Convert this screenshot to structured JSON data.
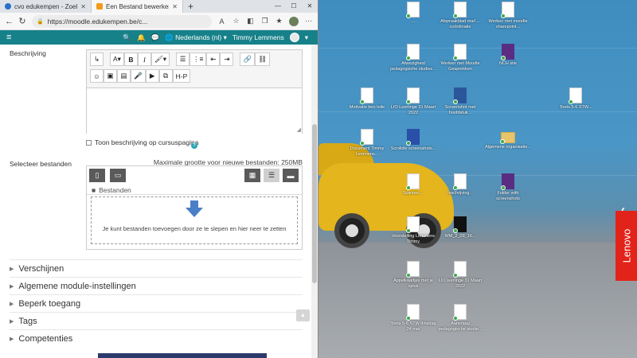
{
  "browser": {
    "tabs": [
      {
        "label": "cvo edukempen - Zoeken",
        "active": false
      },
      {
        "label": "Een Bestand bewerken",
        "active": true
      }
    ],
    "new_tab": "+",
    "url": "https://moodle.edukempen.be/c...",
    "window_controls": {
      "minimize": "—",
      "maximize": "☐",
      "close": "✕"
    }
  },
  "moodle_nav": {
    "language": "Nederlands (nl)",
    "user": "Timmy Lemmens"
  },
  "form": {
    "description_label": "Beschrijving",
    "show_description_label": "Toon beschrijving op cursuspagina",
    "select_files_label": "Selecteer bestanden",
    "max_size_text": "Maximale grootte voor nieuwe bestanden: 250MB",
    "files_crumb": "Bestanden",
    "dropzone_text": "Je kunt bestanden toevoegen door ze te slepen en hier neer te zetten",
    "editor_toolbar": {
      "row1": [
        "↳",
        "A▾",
        "B",
        "I",
        "🖌▾",
        "☰",
        "⋮≡",
        "⇤",
        "⇥",
        "🔗",
        "⛓"
      ],
      "row2": [
        "☺",
        "▣",
        "▤",
        "🎤",
        "▶",
        "⧉",
        "H-P"
      ]
    }
  },
  "sections": [
    {
      "label": "Verschijnen"
    },
    {
      "label": "Algemene module-instellingen"
    },
    {
      "label": "Beperk toegang"
    },
    {
      "label": "Tags"
    },
    {
      "label": "Competenties"
    }
  ],
  "desktop": {
    "brand": "Lenovo",
    "icons": [
      {
        "label": "...",
        "type": "doc"
      },
      {
        "label": "Afspraakblad mail ... coördinatie",
        "type": "doc"
      },
      {
        "label": "Werken met moodle sharepoint...",
        "type": "doc"
      },
      {
        "label": "Afwezigheid pedagogische studiez...",
        "type": "doc"
      },
      {
        "label": "Werken met Moodle Gesprekken",
        "type": "doc"
      },
      {
        "label": "NCH site",
        "type": "app"
      },
      {
        "label": "Motivatie ben toile",
        "type": "doc"
      },
      {
        "label": "LIO Leerlinge 31 Maart 2022",
        "type": "doc"
      },
      {
        "label": "Screenshot met hoofdstuk...",
        "type": "word"
      },
      {
        "label": "Toets 5-6 STW...",
        "type": "doc"
      },
      {
        "label": "Document Timmy Lemmens...",
        "type": "doc"
      },
      {
        "label": "Scrolldiv screenshots...",
        "type": "prog"
      },
      {
        "label": "Algemene organisatie...",
        "type": "folder"
      },
      {
        "label": "Scanner ...",
        "type": "doc"
      },
      {
        "label": "Inschrijving...",
        "type": "doc"
      },
      {
        "label": "Folder with screenshots",
        "type": "app"
      },
      {
        "label": "Voorstelling Lemmens Timmy",
        "type": "doc"
      },
      {
        "label": "WM_2_09_16...",
        "type": "photo"
      },
      {
        "label": "Appelkaartjes met je xplus",
        "type": "doc"
      },
      {
        "label": "LIO leerlinge 31 Maart 2022",
        "type": "doc"
      },
      {
        "label": "Toets 5-6 STW dinsdag 24 mei",
        "type": "doc"
      },
      {
        "label": "Aanvraag pedagogische studie...",
        "type": "doc"
      }
    ]
  },
  "colors": {
    "moodle_nav": "#17818a",
    "browser_chrome": "#dfe3e8",
    "lenovo_red": "#e2231a",
    "taxi_yellow": "#e4b51c"
  }
}
